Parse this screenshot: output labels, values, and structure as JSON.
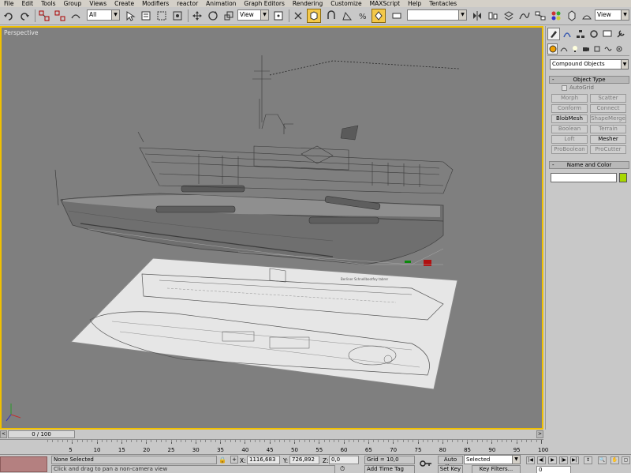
{
  "menu": [
    "File",
    "Edit",
    "Tools",
    "Group",
    "Views",
    "Create",
    "Modifiers",
    "reactor",
    "Animation",
    "Graph Editors",
    "Rendering",
    "Customize",
    "MAXScript",
    "Help",
    "Tentacles"
  ],
  "toolbar": {
    "selection_filter": "All",
    "reference_coord": "View",
    "named_selection": "",
    "render_view": "View"
  },
  "viewport": {
    "label": "Perspective",
    "blueprint_title": "Berliner Schnellbootfoy tabrer",
    "border_color": "#f0c000"
  },
  "command_panel": {
    "category_select": "Compound Objects",
    "object_type_title": "Object Type",
    "autogrid_label": "AutoGrid",
    "buttons": [
      {
        "label": "Morph",
        "enabled": false
      },
      {
        "label": "Scatter",
        "enabled": false
      },
      {
        "label": "Conform",
        "enabled": false
      },
      {
        "label": "Connect",
        "enabled": false
      },
      {
        "label": "BlobMesh",
        "enabled": true
      },
      {
        "label": "ShapeMerge",
        "enabled": false
      },
      {
        "label": "Boolean",
        "enabled": false
      },
      {
        "label": "Terrain",
        "enabled": false
      },
      {
        "label": "Loft",
        "enabled": false
      },
      {
        "label": "Mesher",
        "enabled": true
      },
      {
        "label": "ProBoolean",
        "enabled": false
      },
      {
        "label": "ProCutter",
        "enabled": false
      }
    ],
    "name_color_title": "Name and Color",
    "name_value": "",
    "swatch_color": "#a8d800"
  },
  "timeslider": {
    "frame_label": "0 / 100",
    "left_arrow": "<",
    "right_arrow": ">"
  },
  "track": {
    "ticks": [
      "5",
      "10",
      "15",
      "20",
      "25",
      "30",
      "35",
      "40",
      "45",
      "50",
      "55",
      "60",
      "65",
      "70",
      "75",
      "80",
      "85",
      "90",
      "95",
      "100"
    ]
  },
  "status": {
    "selection_text": "None Selected",
    "prompt_text": "Click and drag to pan a non-camera view",
    "x_label": "X:",
    "x_value": "1116,683",
    "y_label": "Y:",
    "y_value": "726,892",
    "z_label": "Z:",
    "z_value": "0,0",
    "grid_text": "Grid = 10,0",
    "add_time_tag": "Add Time Tag",
    "auto_key": "Auto Key",
    "set_key": "Set Key",
    "selected_select": "Selected",
    "key_filters": "Key Filters...",
    "frame_value": "0"
  }
}
